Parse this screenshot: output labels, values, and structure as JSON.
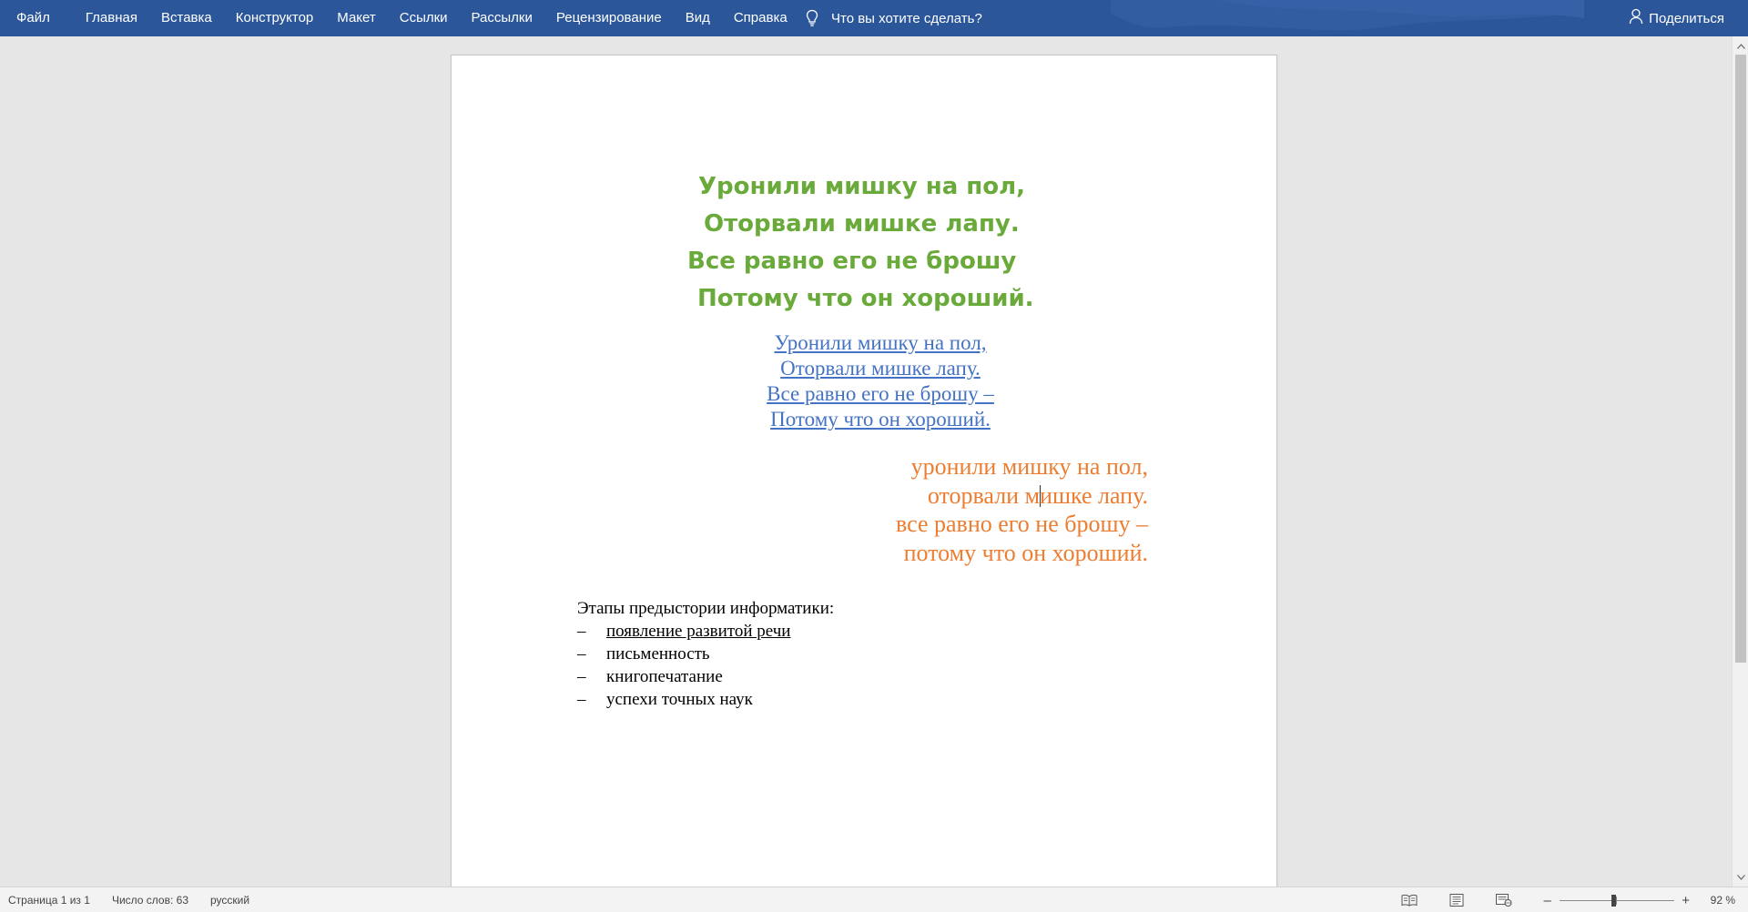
{
  "ribbon": {
    "tabs": [
      "Файл",
      "Главная",
      "Вставка",
      "Конструктор",
      "Макет",
      "Ссылки",
      "Рассылки",
      "Рецензирование",
      "Вид",
      "Справка"
    ],
    "tell_me": "Что вы хотите сделать?",
    "share": "Поделиться",
    "accent_color": "#2b579a"
  },
  "document": {
    "poem_green": [
      "Уронили мишку на пол,",
      "Оторвали мишке лапу.",
      "Все равно его не брошу",
      "Потому что он хороший."
    ],
    "poem_blue": [
      "Уронили мишку на пол,",
      "Оторвали мишке лапу.",
      "Все равно его не брошу –",
      "Потому что он хороший."
    ],
    "poem_orange": {
      "line1": "уронили мишку на пол,",
      "line2_before_cursor": "оторвали м",
      "line2_after_cursor": "ишке лапу.",
      "line3": "все равно его не брошу –",
      "line4": "потому что он хороший."
    },
    "stages": {
      "heading": "Этапы предыстории информатики:",
      "bullet": "–",
      "items": [
        "появление развитой речи",
        "письменность",
        "книгопечатание",
        "успехи точных наук"
      ]
    },
    "colors": {
      "green": "#6aaa3b",
      "blue": "#4472c4",
      "orange": "#ed7d31"
    }
  },
  "status_bar": {
    "page": "Страница 1 из 1",
    "words": "Число слов: 63",
    "language": "русский",
    "zoom_minus": "–",
    "zoom_plus": "+",
    "zoom": "92 %",
    "zoom_percent": 92
  },
  "icons": {
    "tell_me": "lightbulb-icon",
    "share": "person-icon",
    "views": [
      "read-mode-icon",
      "print-layout-icon",
      "web-layout-icon"
    ]
  }
}
